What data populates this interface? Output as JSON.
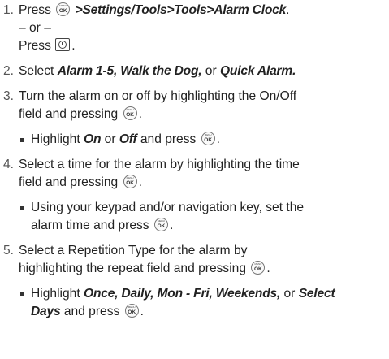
{
  "steps": [
    {
      "num": "1.",
      "press": "Press",
      "path": ">Settings/Tools>Tools>Alarm Clock",
      "path_end": ".",
      "or": "– or –",
      "press2": "Press",
      "press2_end": "."
    },
    {
      "num": "2.",
      "select": "Select",
      "opt1": "Alarm 1-5, Walk the Dog,",
      "or_word": "or",
      "opt2": "Quick Alarm."
    },
    {
      "num": "3.",
      "line1": "Turn the alarm on or off by highlighting the On/Off",
      "line2": "field and pressing",
      "line2_end": ".",
      "bullet_pre": "Highlight",
      "on": "On",
      "or_word": "or",
      "off": "Off",
      "bullet_post": "and press",
      "bullet_end": "."
    },
    {
      "num": "4.",
      "line1": "Select a time for the alarm by highlighting the time",
      "line2": "field and pressing",
      "line2_end": ".",
      "bullet_line1": "Using your keypad and/or navigation key, set the",
      "bullet_line2": "alarm time and press",
      "bullet_end": "."
    },
    {
      "num": "5.",
      "line1": "Select a Repetition Type for the alarm by",
      "line2": "highlighting the repeat field and pressing",
      "line2_end": ".",
      "bullet_pre": "Highlight",
      "opts": "Once, Daily, Mon - Fri, Weekends,",
      "or_word": "or",
      "select_days_1": "Select",
      "select_days_2": "Days",
      "bullet_post": "and press",
      "bullet_end": "."
    }
  ],
  "keys": {
    "menu_top": "MENU",
    "menu_bottom": "OK"
  },
  "icons": {
    "menu_ok": "menu-ok-key-icon",
    "clock": "clock-key-icon"
  }
}
